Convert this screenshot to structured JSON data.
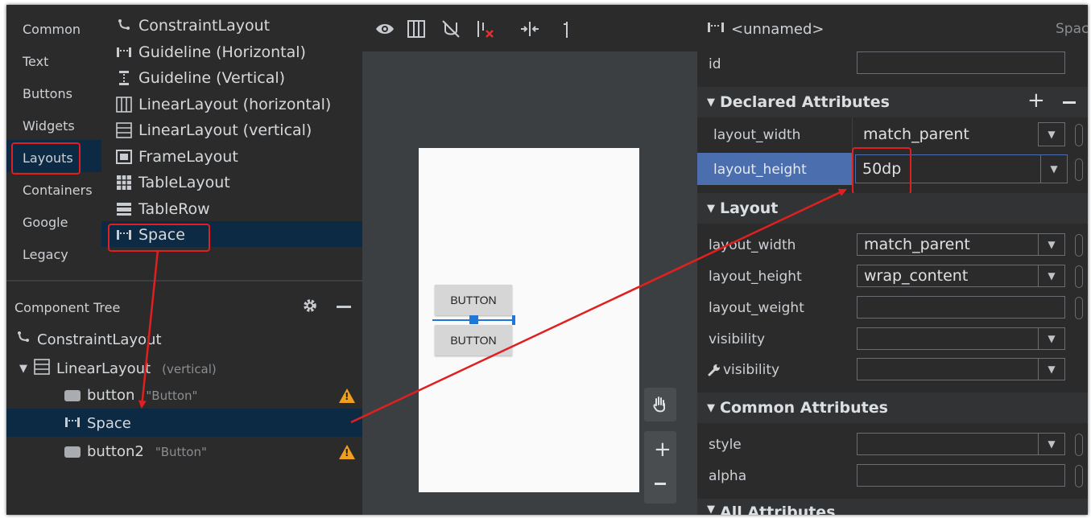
{
  "palette": {
    "categories": [
      "Common",
      "Text",
      "Buttons",
      "Widgets",
      "Layouts",
      "Containers",
      "Google",
      "Legacy"
    ],
    "selected_category": "Layouts",
    "items": [
      {
        "label": "ConstraintLayout",
        "icon": "constraint-layout-icon"
      },
      {
        "label": "Guideline (Horizontal)",
        "icon": "guideline-horizontal-icon"
      },
      {
        "label": "Guideline (Vertical)",
        "icon": "guideline-vertical-icon"
      },
      {
        "label": "LinearLayout (horizontal)",
        "icon": "linear-layout-horizontal-icon"
      },
      {
        "label": "LinearLayout (vertical)",
        "icon": "linear-layout-vertical-icon"
      },
      {
        "label": "FrameLayout",
        "icon": "frame-layout-icon"
      },
      {
        "label": "TableLayout",
        "icon": "table-layout-icon"
      },
      {
        "label": "TableRow",
        "icon": "table-row-icon"
      },
      {
        "label": "Space",
        "icon": "space-icon"
      }
    ],
    "selected_item": "Space"
  },
  "component_tree": {
    "title": "Component Tree",
    "rows": [
      {
        "label": "ConstraintLayout",
        "hint": ""
      },
      {
        "label": "LinearLayout",
        "hint": "(vertical)"
      },
      {
        "label": "button",
        "hint": "\"Button\""
      },
      {
        "label": "Space",
        "hint": ""
      },
      {
        "label": "button2",
        "hint": "\"Button\""
      }
    ]
  },
  "preview": {
    "button1": "BUTTON",
    "button2": "BUTTON"
  },
  "attributes": {
    "header_title": "<unnamed>",
    "header_right": "Space",
    "id_label": "id",
    "id_value": "",
    "declared": {
      "title": "Declared Attributes",
      "rows": [
        {
          "label": "layout_width",
          "value": "match_parent"
        },
        {
          "label": "layout_height",
          "value": "50dp"
        }
      ]
    },
    "layout": {
      "title": "Layout",
      "rows": [
        {
          "label": "layout_width",
          "value": "match_parent"
        },
        {
          "label": "layout_height",
          "value": "wrap_content"
        },
        {
          "label": "layout_weight",
          "value": ""
        },
        {
          "label": "visibility",
          "value": ""
        },
        {
          "label": "visibility",
          "value": ""
        }
      ]
    },
    "common": {
      "title": "Common Attributes",
      "rows": [
        {
          "label": "style",
          "value": ""
        },
        {
          "label": "alpha",
          "value": ""
        }
      ]
    },
    "all_title": "All Attributes"
  },
  "colors": {
    "selection_blue": "#4b6eaf",
    "highlight_red": "#e02020",
    "warning_orange": "#f0a020"
  }
}
